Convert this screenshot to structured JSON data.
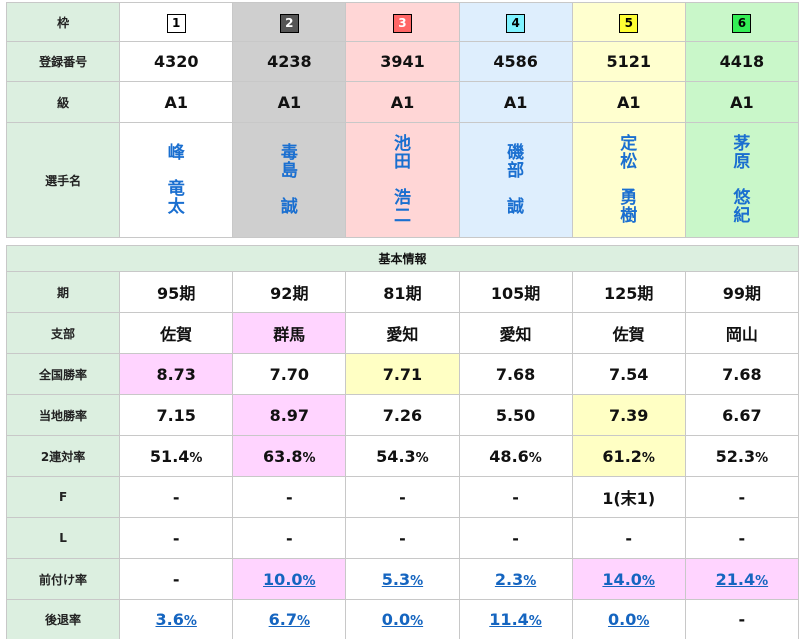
{
  "labels": {
    "waku": "枠",
    "reg": "登録番号",
    "class": "級",
    "name": "選手名",
    "section": "基本情報",
    "period": "期",
    "branch": "支部",
    "national": "全国勝率",
    "local": "当地勝率",
    "two_rate": "2連対率",
    "f": "F",
    "l": "L",
    "mae": "前付け率",
    "ato": "後退率"
  },
  "racers": [
    {
      "waku": "1",
      "reg": "4320",
      "class": "A1",
      "name": "峰\n竜太",
      "name_lines": [
        "峰",
        "",
        "竜",
        "太"
      ],
      "period": "95期",
      "branch": "佐賀",
      "national": "8.73",
      "local": "7.15",
      "two_rate": "51.4",
      "f": "-",
      "l": "-",
      "mae": "-",
      "ato": "3.6"
    },
    {
      "waku": "2",
      "reg": "4238",
      "class": "A1",
      "name_lines": [
        "毒",
        "島",
        "",
        "誠"
      ],
      "period": "92期",
      "branch": "群馬",
      "national": "7.70",
      "local": "8.97",
      "two_rate": "63.8",
      "f": "-",
      "l": "-",
      "mae": "10.0",
      "ato": "6.7"
    },
    {
      "waku": "3",
      "reg": "3941",
      "class": "A1",
      "name_lines": [
        "池",
        "田",
        "",
        "浩",
        "二"
      ],
      "period": "81期",
      "branch": "愛知",
      "national": "7.71",
      "local": "7.26",
      "two_rate": "54.3",
      "f": "-",
      "l": "-",
      "mae": "5.3",
      "ato": "0.0"
    },
    {
      "waku": "4",
      "reg": "4586",
      "class": "A1",
      "name_lines": [
        "磯",
        "部",
        "",
        "誠"
      ],
      "period": "105期",
      "branch": "愛知",
      "national": "7.68",
      "local": "5.50",
      "two_rate": "48.6",
      "f": "-",
      "l": "-",
      "mae": "2.3",
      "ato": "11.4"
    },
    {
      "waku": "5",
      "reg": "5121",
      "class": "A1",
      "name_lines": [
        "定",
        "松",
        "",
        "勇",
        "樹"
      ],
      "period": "125期",
      "branch": "佐賀",
      "national": "7.54",
      "local": "7.39",
      "two_rate": "61.2",
      "f": "1(末1)",
      "l": "-",
      "mae": "14.0",
      "ato": "0.0"
    },
    {
      "waku": "6",
      "reg": "4418",
      "class": "A1",
      "name_lines": [
        "茅",
        "原",
        "",
        "悠",
        "紀"
      ],
      "period": "99期",
      "branch": "岡山",
      "national": "7.68",
      "local": "6.67",
      "two_rate": "52.3",
      "f": "-",
      "l": "-",
      "mae": "21.4",
      "ato": "-"
    }
  ],
  "unit_pct": "%",
  "colors": {
    "header_bg": "#dcefe0",
    "highlight_pink": "#ffd4ff",
    "highlight_yellow": "#ffffc4",
    "link": "#1565c0",
    "name": "#1a6fd0"
  }
}
